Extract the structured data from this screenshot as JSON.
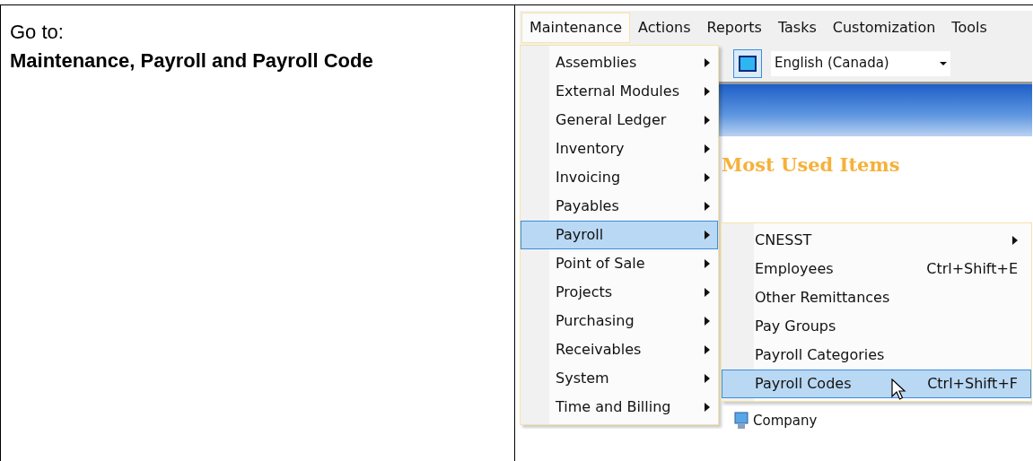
{
  "instruction": {
    "lead": "Go to:",
    "path": "Maintenance, Payroll and Payroll Code"
  },
  "app": {
    "menu_bar": [
      {
        "label": "Maintenance",
        "selected": true
      },
      {
        "label": "Actions",
        "selected": false
      },
      {
        "label": "Reports",
        "selected": false
      },
      {
        "label": "Tasks",
        "selected": false
      },
      {
        "label": "Customization",
        "selected": false
      },
      {
        "label": "Tools",
        "selected": false
      }
    ],
    "language": {
      "value": "English (Canada)"
    },
    "section_title": "Most Used Items",
    "items": [
      {
        "label": "Company"
      }
    ],
    "menu": [
      {
        "label": "Assemblies",
        "selected": false
      },
      {
        "label": "External Modules",
        "selected": false
      },
      {
        "label": "General Ledger",
        "selected": false
      },
      {
        "label": "Inventory",
        "selected": false
      },
      {
        "label": "Invoicing",
        "selected": false
      },
      {
        "label": "Payables",
        "selected": false
      },
      {
        "label": "Payroll",
        "selected": true
      },
      {
        "label": "Point of Sale",
        "selected": false
      },
      {
        "label": "Projects",
        "selected": false
      },
      {
        "label": "Purchasing",
        "selected": false
      },
      {
        "label": "Receivables",
        "selected": false
      },
      {
        "label": "System",
        "selected": false
      },
      {
        "label": "Time and Billing",
        "selected": false
      }
    ],
    "submenu": [
      {
        "kind": "submenu",
        "label": "CNESST",
        "selected": false
      },
      {
        "kind": "command",
        "label": "Employees",
        "shortcut": "Ctrl+Shift+E",
        "selected": false
      },
      {
        "kind": "command",
        "label": "Other Remittances",
        "selected": false
      },
      {
        "kind": "command",
        "label": "Pay Groups",
        "selected": false
      },
      {
        "kind": "command",
        "label": "Payroll Categories",
        "selected": false
      },
      {
        "kind": "command",
        "label": "Payroll Codes",
        "shortcut": "Ctrl+Shift+F",
        "selected": true
      }
    ]
  }
}
